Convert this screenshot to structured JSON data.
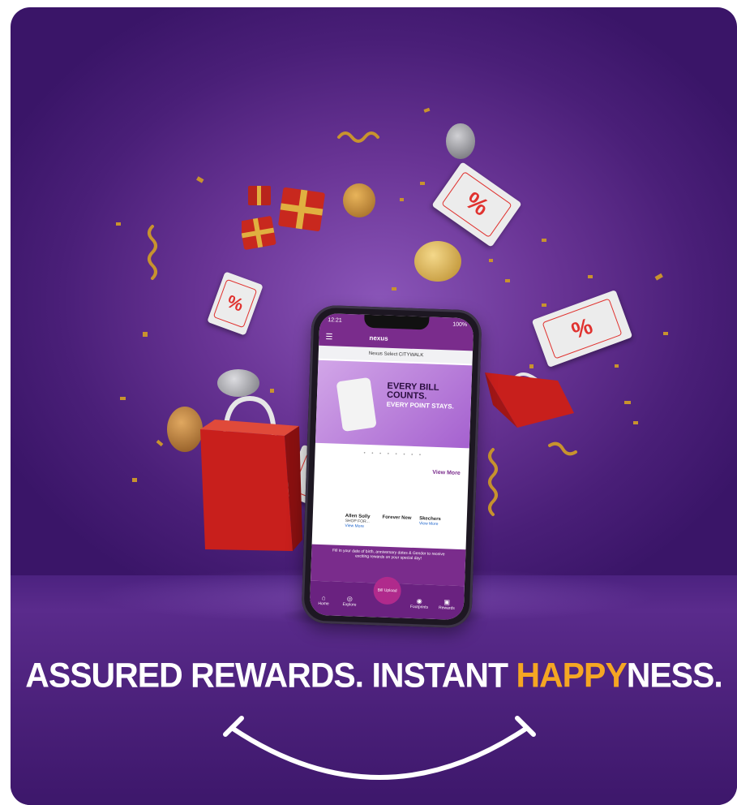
{
  "headline": {
    "part1": "ASSURED REWARDS. INSTANT ",
    "highlight": "HAPPY",
    "part2": "NESS."
  },
  "phone_screen": {
    "time": "12:21",
    "status": "100%",
    "app_name": "nexus",
    "location": "Nexus Select CITYWALK",
    "banner_line1": "EVERY BILL COUNTS.",
    "banner_line2": "EVERY POINT STAYS.",
    "view_more": "View More",
    "brands": [
      {
        "name": "Allen Solly",
        "sub": "SHOP FOR...",
        "link": "View More"
      },
      {
        "name": "Forever New",
        "sub": "",
        "link": ""
      },
      {
        "name": "Skechers",
        "sub": "",
        "link": "View More"
      }
    ],
    "promo_text": "Fill in your date of birth, anniversary dates & Gender to receive exciting rewards on your special day!",
    "nav": [
      "Home",
      "Explore",
      "Bill Upload",
      "Footprints",
      "Rewards"
    ]
  },
  "colors": {
    "background": "#5a2b8c",
    "accent": "#f5a623",
    "text": "#ffffff",
    "coupon_red": "#e0322f"
  }
}
